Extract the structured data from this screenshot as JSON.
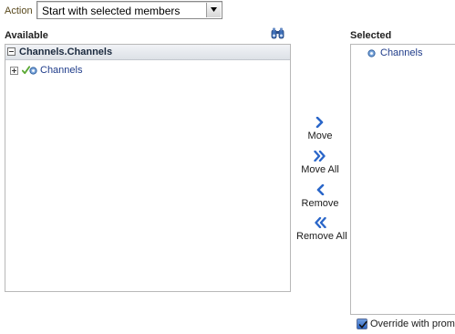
{
  "action": {
    "label": "Action",
    "selected_value": "Start with selected members"
  },
  "available": {
    "title": "Available",
    "header_label": "Channels.Channels",
    "tree": [
      {
        "label": "Channels",
        "checked": true
      }
    ]
  },
  "shuttle": {
    "move": "Move",
    "move_all": "Move All",
    "remove": "Remove",
    "remove_all": "Remove All"
  },
  "selected": {
    "title": "Selected",
    "items": [
      {
        "label": "Channels"
      }
    ]
  },
  "override": {
    "label": "Override with prompt",
    "checked": true
  },
  "colors": {
    "link_text": "#1f3c8a",
    "shuttle_arrow": "#2a66c9",
    "check_green": "#5aa832",
    "header_gradient_top": "#f1f3f6",
    "header_gradient_bottom": "#dde1e7"
  }
}
